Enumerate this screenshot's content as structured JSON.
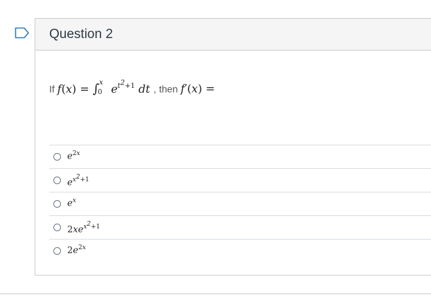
{
  "question": {
    "title": "Question 2",
    "prompt_prefix": "If",
    "prompt_mid": ", then",
    "answers": [
      "e^{2x}",
      "e^{x^2+1}",
      "e^{x}",
      "2xe^{x^2+1}",
      "2e^{2x}"
    ]
  },
  "icons": {
    "bookmark": "bookmark-flag-icon",
    "accent_color": "#2b7abc"
  }
}
